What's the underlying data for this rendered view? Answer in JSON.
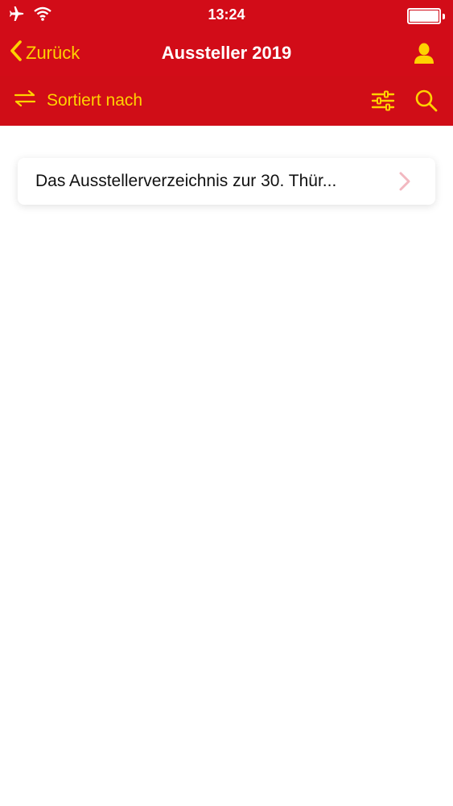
{
  "status_bar": {
    "time": "13:24"
  },
  "nav": {
    "back_label": "Zurück",
    "title": "Aussteller 2019"
  },
  "toolbar": {
    "sort_label": "Sortiert nach"
  },
  "list": {
    "items": [
      {
        "title": "Das Ausstellerverzeichnis zur 30. Thür..."
      }
    ]
  },
  "colors": {
    "brand_red": "#d20c18",
    "accent_yellow": "#ffd200",
    "chevron": "#f2b8c0"
  }
}
